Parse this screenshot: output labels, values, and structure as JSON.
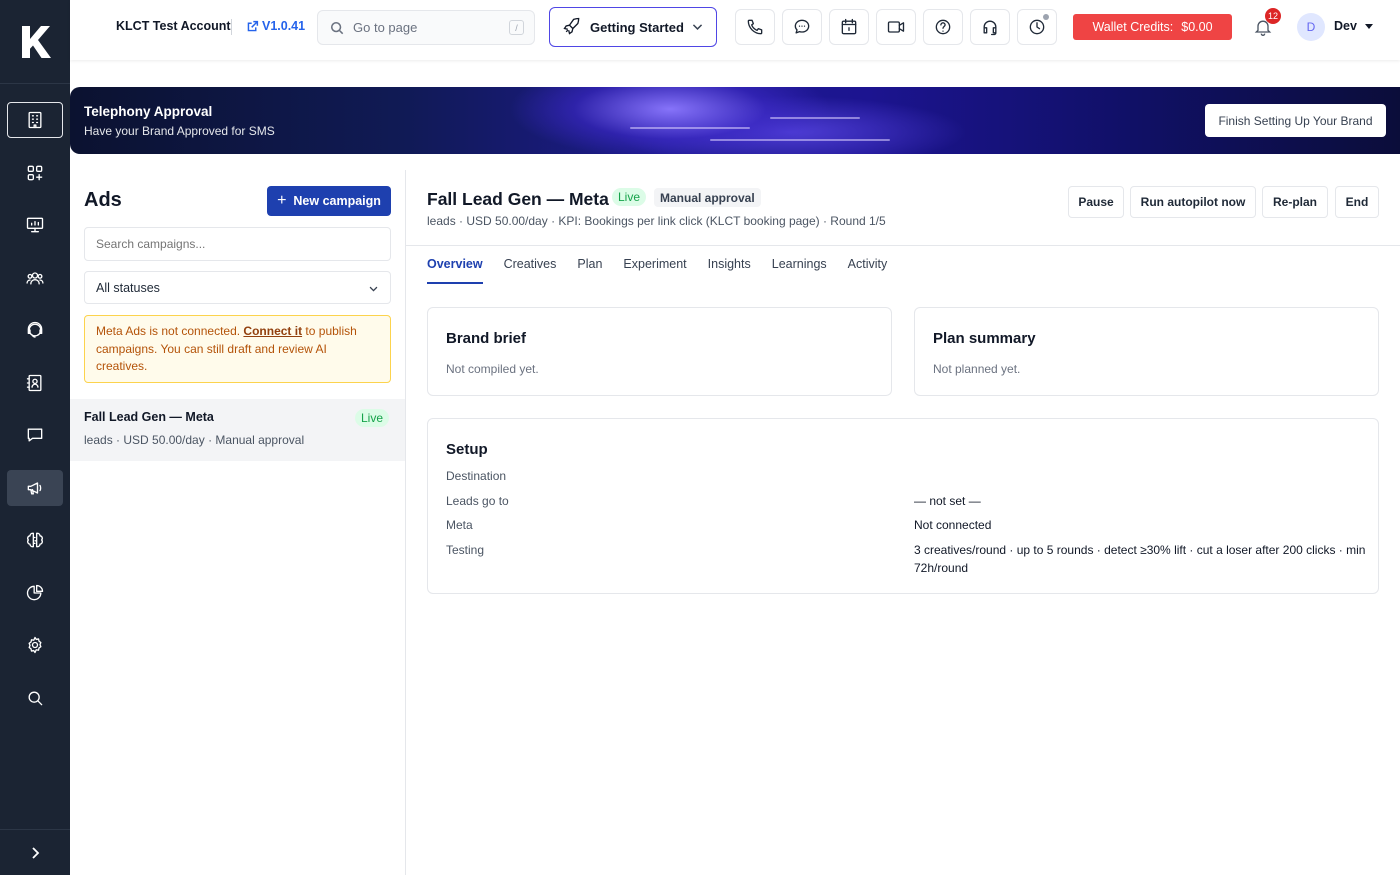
{
  "app": {
    "logo_letter": "K",
    "account_name": "KLCT Test Account",
    "version": "V1.0.41"
  },
  "topbar": {
    "search_placeholder": "Go to page",
    "search_shortcut": "/",
    "getting_started_label": "Getting Started",
    "wallet_label": "Wallet Credits:",
    "wallet_amount": "$0.00",
    "notification_count": "12",
    "avatar_initial": "D",
    "user_name": "Dev",
    "icons": [
      "phone-icon",
      "chat-icon",
      "calendar-icon",
      "video-icon",
      "help-icon",
      "headset-icon",
      "clock-icon"
    ]
  },
  "sidebar": {
    "items": [
      "building-icon",
      "apps-icon",
      "presentation-icon",
      "users-icon",
      "support-icon",
      "contacts-icon",
      "messages-icon",
      "megaphone-icon",
      "brain-icon",
      "analytics-icon",
      "settings-icon",
      "search-icon"
    ],
    "active_item": "megaphone-icon"
  },
  "banner": {
    "title": "Telephony Approval",
    "subtitle": "Have your Brand Approved for SMS",
    "button_label": "Finish Setting Up Your Brand"
  },
  "ads": {
    "title": "Ads",
    "new_campaign_label": "New campaign",
    "search_placeholder": "Search campaigns...",
    "status_filter": "All statuses",
    "warning": {
      "text_before": "Meta Ads is not connected. ",
      "link": "Connect it",
      "text_after": " to publish campaigns. You can still draft and review AI creatives."
    },
    "campaigns": [
      {
        "title": "Fall Lead Gen — Meta",
        "status": "Live",
        "subtitle": "leads · USD 50.00/day · Manual approval"
      }
    ]
  },
  "campaign": {
    "title": "Fall Lead Gen — Meta",
    "status": "Live",
    "approval": "Manual approval",
    "subtitle": "leads · USD 50.00/day · KPI: Bookings per link click (KLCT booking page) · Round 1/5",
    "actions": {
      "pause": "Pause",
      "run_autopilot": "Run autopilot now",
      "replan": "Re-plan",
      "end": "End"
    },
    "tabs": [
      "Overview",
      "Creatives",
      "Plan",
      "Experiment",
      "Insights",
      "Learnings",
      "Activity"
    ],
    "active_tab": "Overview",
    "brand_brief": {
      "title": "Brand brief",
      "text": "Not compiled yet."
    },
    "plan_summary": {
      "title": "Plan summary",
      "text": "Not planned yet."
    },
    "setup": {
      "title": "Setup",
      "rows": [
        {
          "label": "Destination",
          "value": ""
        },
        {
          "label": "Leads go to",
          "value": "— not set —"
        },
        {
          "label": "Meta",
          "value": "Not connected"
        },
        {
          "label": "Testing",
          "value": "3 creatives/round · up to 5 rounds · detect ≥30% lift · cut a loser after 200 clicks · min 72h/round"
        }
      ]
    }
  },
  "colors": {
    "sidebar_bg": "#1b2433",
    "primary": "#1e40af",
    "wallet": "#ef4444",
    "live_badge_bg": "#dcfce7",
    "live_badge_text": "#16a34a",
    "warning_bg": "#fffbeb",
    "warning_border": "#fcd34d"
  }
}
